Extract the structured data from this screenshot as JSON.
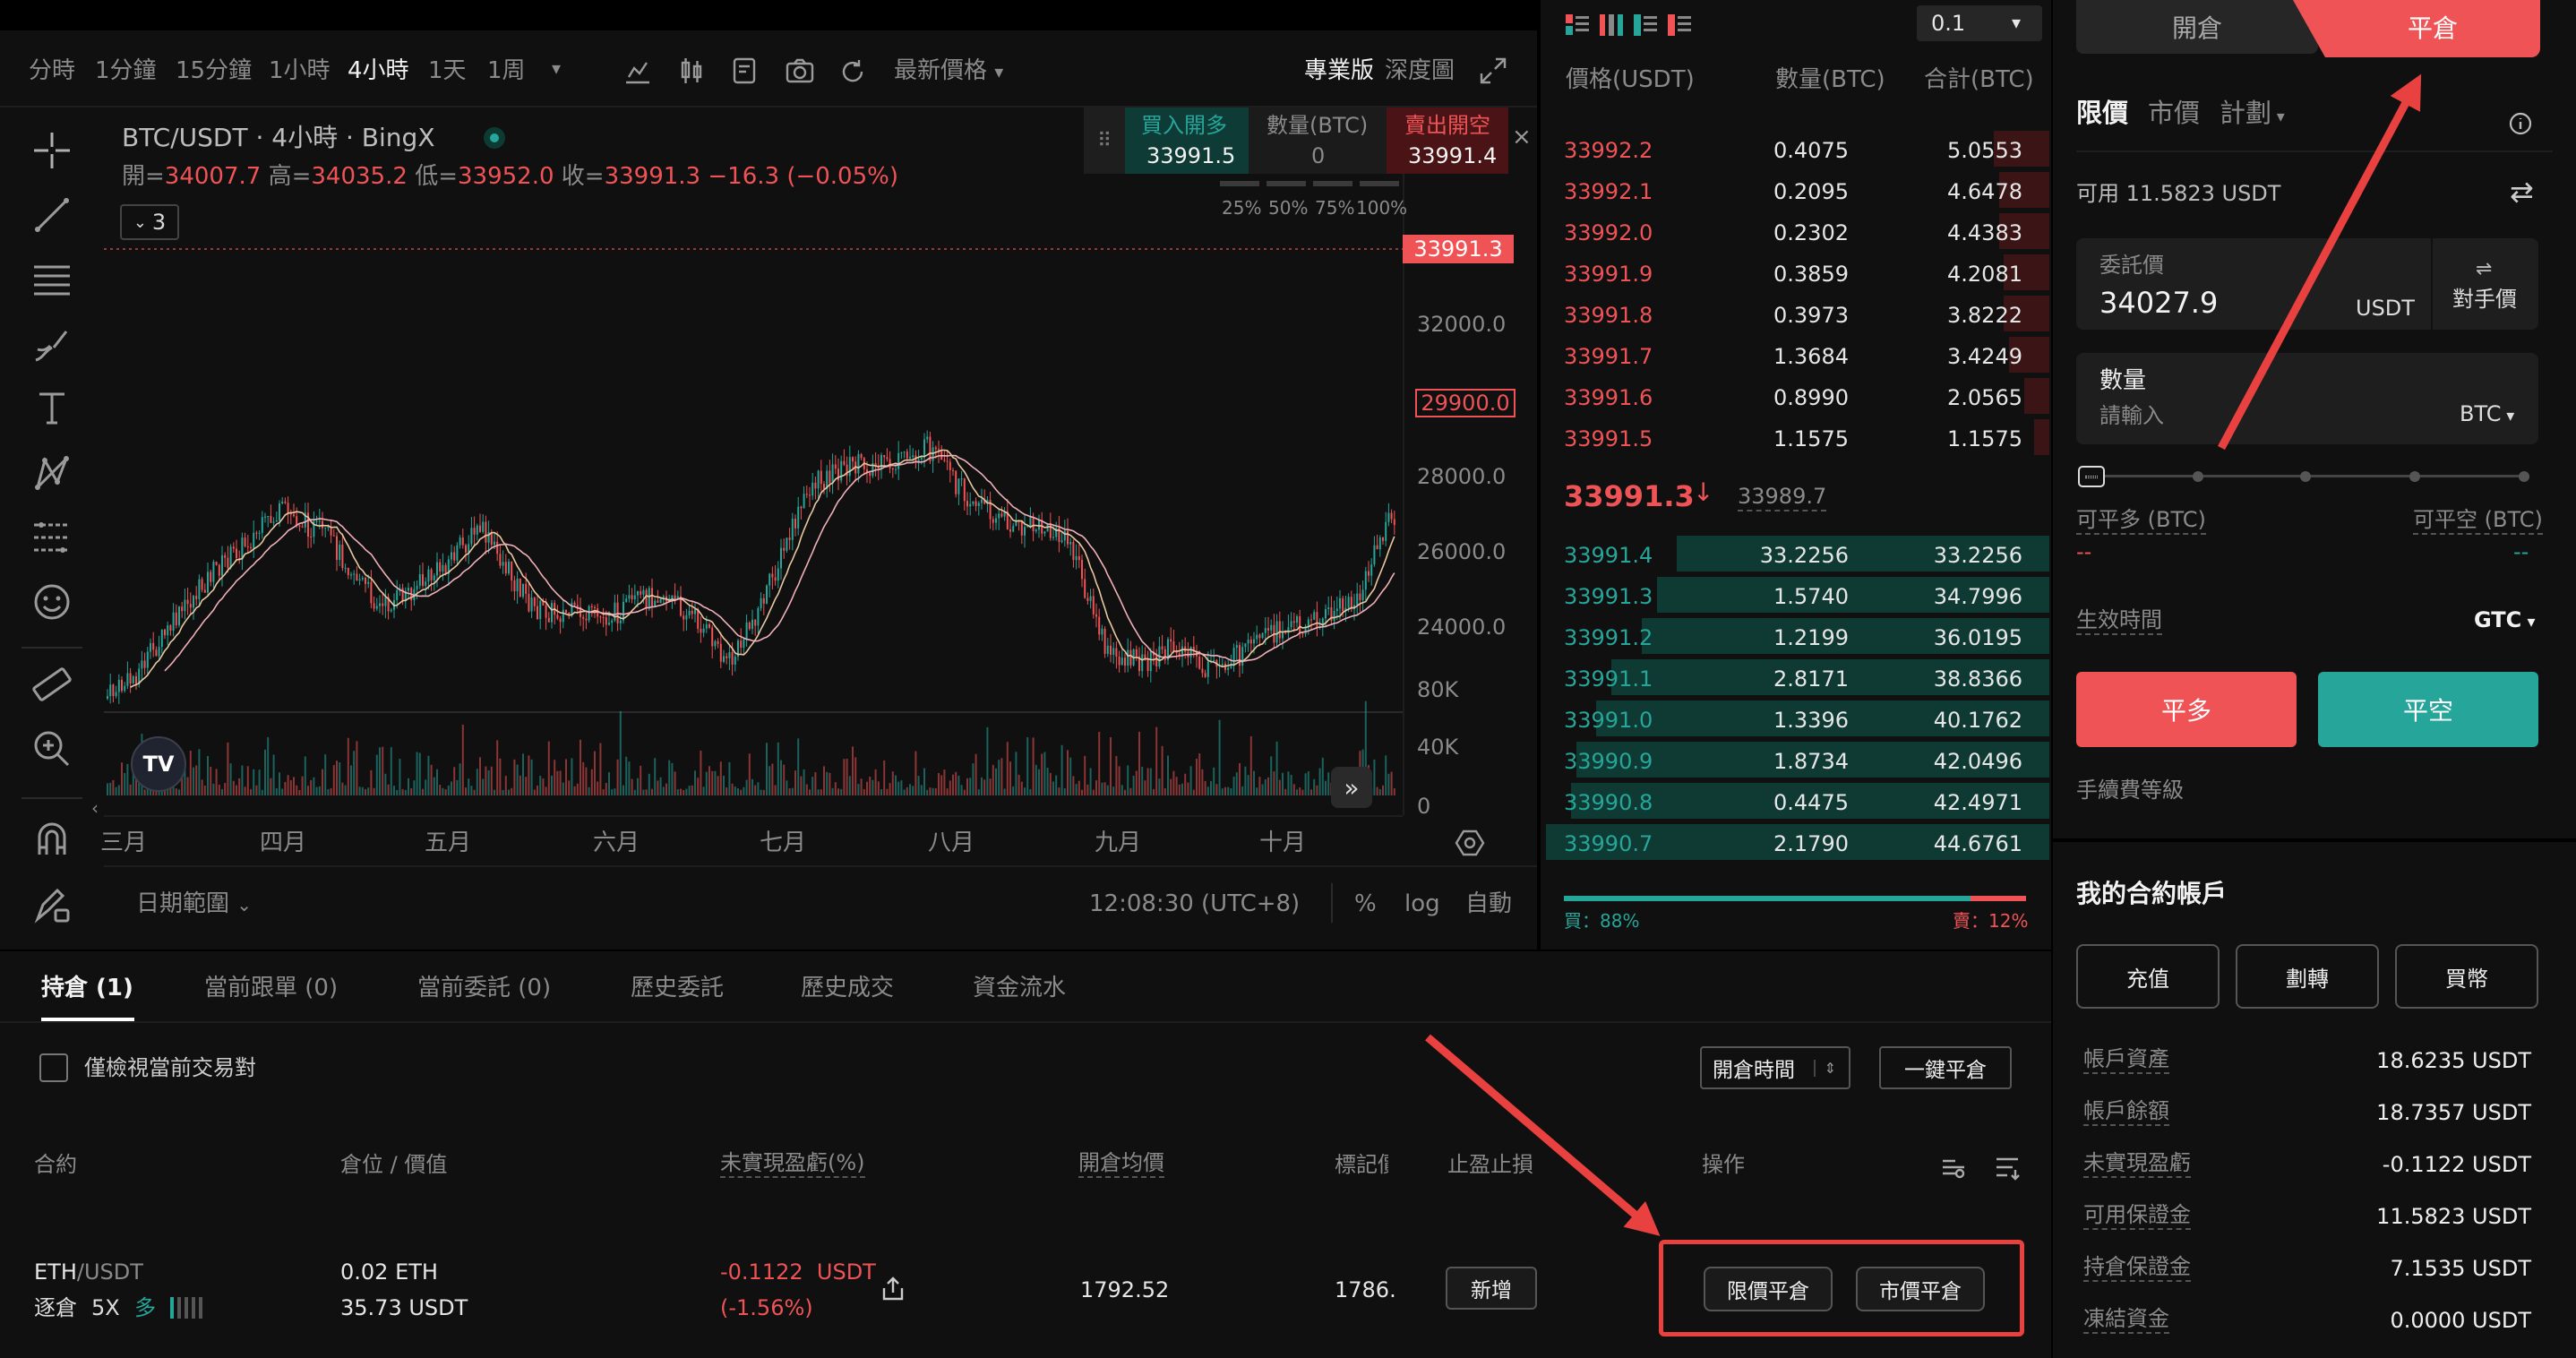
{
  "toolbar": {
    "timeframes": [
      "分時",
      "1分鐘",
      "15分鐘",
      "1小時",
      "4小時",
      "1天",
      "1周"
    ],
    "price_type": "最新價格",
    "pro": "專業版",
    "depth": "深度圖"
  },
  "chart": {
    "title": "BTC/USDT · 4小時 · BingX",
    "open_label": "開=",
    "open": "34007.7",
    "high_label": "高=",
    "high": "34035.2",
    "low_label": "低=",
    "low": "33952.0",
    "close_label": "收=",
    "close": "33991.3",
    "change": "−16.3 (−0.05%)",
    "indicators_count": "3",
    "last_price_tag": "33991.3",
    "marker_tag": "29900.0",
    "price_axis": [
      "32000.0",
      "28000.0",
      "26000.0",
      "24000.0"
    ],
    "volume_axis": [
      "80K",
      "40K",
      "0"
    ],
    "months": [
      "三月",
      "四月",
      "五月",
      "六月",
      "七月",
      "八月",
      "九月",
      "十月"
    ],
    "date_range": "日期範圍",
    "time": "12:08:30 (UTC+8)",
    "pct": "%",
    "log": "log",
    "auto": "自動",
    "tv_logo": "TV"
  },
  "quick_trade": {
    "buy_label": "買入開多",
    "buy_price": "33991.5",
    "qty_label": "數量(BTC)",
    "qty_value": "0",
    "sell_label": "賣出開空",
    "sell_price": "33991.4",
    "percents": [
      "25%",
      "50%",
      "75%",
      "100%"
    ]
  },
  "orderbook": {
    "precision": "0.1",
    "headers": [
      "價格(USDT)",
      "數量(BTC)",
      "合計(BTC)"
    ],
    "asks": [
      {
        "price": "33992.2",
        "qty": "0.4075",
        "total": "5.0553",
        "depth": 0.11
      },
      {
        "price": "33992.1",
        "qty": "0.2095",
        "total": "4.6478",
        "depth": 0.1
      },
      {
        "price": "33992.0",
        "qty": "0.2302",
        "total": "4.4383",
        "depth": 0.1
      },
      {
        "price": "33991.9",
        "qty": "0.3859",
        "total": "4.2081",
        "depth": 0.09
      },
      {
        "price": "33991.8",
        "qty": "0.3973",
        "total": "3.8222",
        "depth": 0.09
      },
      {
        "price": "33991.7",
        "qty": "1.3684",
        "total": "3.4249",
        "depth": 0.08
      },
      {
        "price": "33991.6",
        "qty": "0.8990",
        "total": "2.0565",
        "depth": 0.05
      },
      {
        "price": "33991.5",
        "qty": "1.1575",
        "total": "1.1575",
        "depth": 0.03
      }
    ],
    "mid_price": "33991.3",
    "mark_price": "33989.7",
    "bids": [
      {
        "price": "33991.4",
        "qty": "33.2256",
        "total": "33.2256",
        "depth": 0.74
      },
      {
        "price": "33991.3",
        "qty": "1.5740",
        "total": "34.7996",
        "depth": 0.78
      },
      {
        "price": "33991.2",
        "qty": "1.2199",
        "total": "36.0195",
        "depth": 0.81
      },
      {
        "price": "33991.1",
        "qty": "2.8171",
        "total": "38.8366",
        "depth": 0.87
      },
      {
        "price": "33991.0",
        "qty": "1.3396",
        "total": "40.1762",
        "depth": 0.9
      },
      {
        "price": "33990.9",
        "qty": "1.8734",
        "total": "42.0496",
        "depth": 0.94
      },
      {
        "price": "33990.8",
        "qty": "0.4475",
        "total": "42.4971",
        "depth": 0.95
      },
      {
        "price": "33990.7",
        "qty": "2.1790",
        "total": "44.6761",
        "depth": 1.0
      }
    ],
    "buy_ratio_label": "買：88%",
    "sell_ratio_label": "賣：12%",
    "buy_ratio": 0.88
  },
  "order_panel": {
    "tab_open": "開倉",
    "tab_close": "平倉",
    "types": [
      "限價",
      "市價",
      "計劃"
    ],
    "available": "可用 11.5823 USDT",
    "price_label": "委託價",
    "price_value": "34027.9",
    "price_unit": "USDT",
    "counter_price": "對手價",
    "qty_label": "數量",
    "qty_placeholder": "請輸入",
    "qty_unit": "BTC",
    "closable_long": "可平多 (BTC)",
    "closable_short": "可平空 (BTC)",
    "closable_long_val": "--",
    "closable_short_val": "--",
    "validity_label": "生效時間",
    "validity_value": "GTC",
    "close_long": "平多",
    "close_short": "平空",
    "fee_level": "手續費等級"
  },
  "account": {
    "title": "我的合約帳戶",
    "buttons": [
      "充值",
      "劃轉",
      "買幣"
    ],
    "rows": [
      {
        "label": "帳戶資產",
        "value": "18.6235 USDT"
      },
      {
        "label": "帳戶餘額",
        "value": "18.7357 USDT"
      },
      {
        "label": "未實現盈虧",
        "value": "-0.1122 USDT"
      },
      {
        "label": "可用保證金",
        "value": "11.5823 USDT"
      },
      {
        "label": "持倉保證金",
        "value": "7.1535 USDT"
      },
      {
        "label": "凍結資金",
        "value": "0.0000 USDT"
      }
    ]
  },
  "positions": {
    "tabs": [
      "持倉 (1)",
      "當前跟單 (0)",
      "當前委託 (0)",
      "歷史委託",
      "歷史成交",
      "資金流水"
    ],
    "filter_label": "僅檢視當前交易對",
    "sort_label": "開倉時間",
    "close_all": "一鍵平倉",
    "headers": [
      "合約",
      "倉位 / 價值",
      "未實現盈虧(%)",
      "開倉均價",
      "標記價",
      "止盈止損",
      "操作"
    ],
    "row": {
      "pair_base": "ETH",
      "pair_quote": "/USDT",
      "margin_mode": "逐倉",
      "leverage": "5X",
      "side": "多",
      "size": "0.02 ETH",
      "value": "35.73 USDT",
      "pnl": "-0.1122  USDT",
      "pnl_pct": "(-1.56%)",
      "entry": "1792.52",
      "mark": "1786.",
      "tpsl_add": "新增",
      "limit_close": "限價平倉",
      "market_close": "市價平倉"
    }
  },
  "colors": {
    "green": "#26a69a",
    "red": "#f05356",
    "annotation": "#e8413f"
  }
}
